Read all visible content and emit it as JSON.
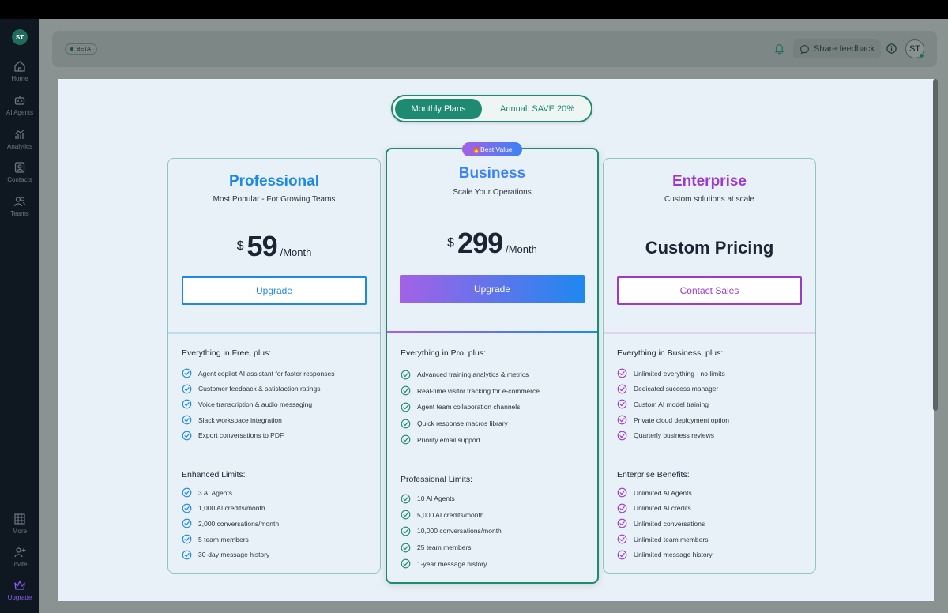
{
  "sidebar": {
    "logo": "ST",
    "items": [
      {
        "label": "Home",
        "icon": "home-icon"
      },
      {
        "label": "AI Agents",
        "icon": "robot-icon"
      },
      {
        "label": "Analytics",
        "icon": "chart-icon"
      },
      {
        "label": "Contacts",
        "icon": "contacts-icon"
      },
      {
        "label": "Teams",
        "icon": "teams-icon"
      },
      {
        "label": "More",
        "icon": "grid-icon"
      },
      {
        "label": "Invite",
        "icon": "add-user-icon"
      },
      {
        "label": "Upgrade",
        "icon": "crown-icon"
      }
    ]
  },
  "header": {
    "beta": "BETA",
    "feedback": "Share feedback",
    "avatar": "ST"
  },
  "toggle": {
    "monthly": "Monthly Plans",
    "annual": "Annual: SAVE 20%"
  },
  "badge": "🔥Best Value",
  "colors": {
    "brand_green": "#1f8a72",
    "pro_blue": "#1e88e5",
    "enterprise_purple": "#9c3bc9"
  },
  "plans": {
    "professional": {
      "name": "Professional",
      "tagline": "Most Popular - For Growing Teams",
      "currency": "$",
      "amount": "59",
      "period": "/Month",
      "button": "Upgrade",
      "features_title": "Everything in Free, plus:",
      "features": [
        "Agent copilot AI assistant for faster responses",
        "Customer feedback & satisfaction ratings",
        "Voice transcription & audio messaging",
        "Slack workspace integration",
        "Export conversations to PDF"
      ],
      "limits_title": "Enhanced Limits:",
      "limits": [
        "3 AI Agents",
        "1,000 AI credits/month",
        "2,000 conversations/month",
        "5 team members",
        "30-day message history"
      ]
    },
    "business": {
      "name": "Business",
      "tagline": "Scale Your Operations",
      "currency": "$",
      "amount": "299",
      "period": "/Month",
      "button": "Upgrade",
      "features_title": "Everything in Pro, plus:",
      "features": [
        "Advanced training analytics & metrics",
        "Real-time visitor tracking for e-commerce",
        "Agent team collaboration channels",
        "Quick response macros library",
        "Priority email support"
      ],
      "limits_title": "Professional Limits:",
      "limits": [
        "10 AI Agents",
        "5,000 AI credits/month",
        "10,000 conversations/month",
        "25 team members",
        "1-year message history"
      ]
    },
    "enterprise": {
      "name": "Enterprise",
      "tagline": "Custom solutions at scale",
      "price": "Custom Pricing",
      "button": "Contact Sales",
      "features_title": "Everything in Business, plus:",
      "features": [
        "Unlimited everything - no limits",
        "Dedicated success manager",
        "Custom AI model training",
        "Private cloud deployment option",
        "Quarterly business reviews"
      ],
      "limits_title": "Enterprise Benefits:",
      "limits": [
        "Unlimited AI Agents",
        "Unlimited AI credits",
        "Unlimited conversations",
        "Unlimited team members",
        "Unlimited message history"
      ]
    }
  }
}
